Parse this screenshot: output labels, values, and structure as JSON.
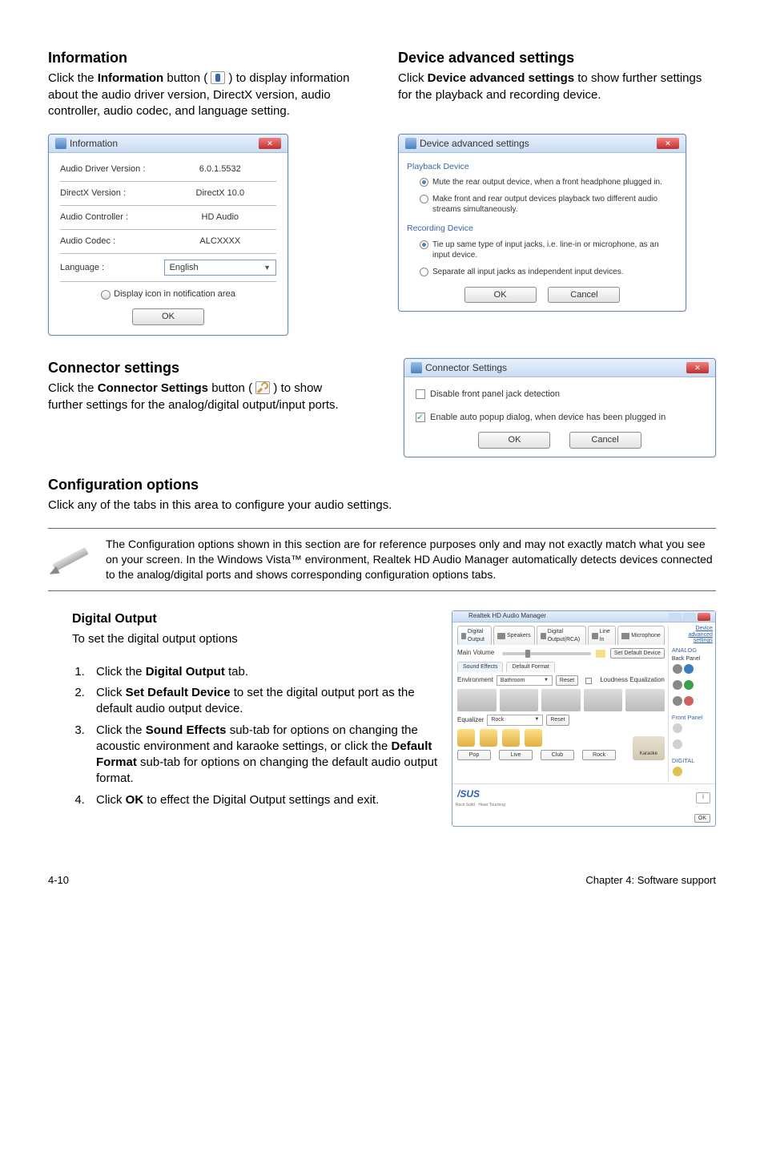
{
  "section1": {
    "left": {
      "heading": "Information",
      "para_a": "Click the ",
      "para_b": "Information",
      "para_c": " button ( ",
      "para_d": " ) to display information about the audio driver version, DirectX version, audio controller, audio codec, and language setting."
    },
    "right": {
      "heading": "Device advanced settings",
      "para_a": "Click ",
      "para_b": "Device advanced settings",
      "para_c": " to show further settings for the playback and recording device."
    }
  },
  "info_dlg": {
    "title": "Information",
    "rows": {
      "driver_label": "Audio Driver Version :",
      "driver_val": "6.0.1.5532",
      "directx_label": "DirectX Version :",
      "directx_val": "DirectX 10.0",
      "controller_label": "Audio Controller :",
      "controller_val": "HD Audio",
      "codec_label": "Audio Codec :",
      "codec_val": "ALCXXXX",
      "lang_label": "Language :",
      "lang_val": "English"
    },
    "notif": "Display icon in notification area",
    "ok": "OK"
  },
  "dev_dlg": {
    "title": "Device advanced settings",
    "playback_grp": "Playback Device",
    "opt1": "Mute the rear output device, when a front headphone plugged in.",
    "opt2": "Make front and rear output devices playback two different audio streams simultaneously.",
    "record_grp": "Recording Device",
    "opt3": "Tie up same type of input jacks, i.e. line-in or microphone, as an input device.",
    "opt4": "Separate all input jacks as independent input devices.",
    "ok": "OK",
    "cancel": "Cancel"
  },
  "conn": {
    "heading": "Connector settings",
    "para_a": "Click the ",
    "para_b": "Connector Settings",
    "para_c": " button ( ",
    "para_d": " ) to show further settings for the analog/digital output/input ports.",
    "dlg_title": "Connector Settings",
    "opt1": "Disable front panel jack detection",
    "opt2": "Enable auto popup dialog, when device has been plugged in",
    "ok": "OK",
    "cancel": "Cancel"
  },
  "cfg": {
    "heading": "Configuration options",
    "intro": "Click any of the tabs in this area to configure your audio settings.",
    "note": "The Configuration options shown in this section are for reference purposes only and may not exactly match what you see on your screen. In the Windows Vista™ environment, Realtek HD Audio Manager automatically detects devices connected to the analog/digital ports and shows corresponding configuration options tabs."
  },
  "digital": {
    "heading": "Digital Output",
    "intro": "To set the digital output options",
    "s1a": "Click the ",
    "s1b": "Digital Output",
    "s1c": " tab.",
    "s2a": "Click ",
    "s2b": "Set Default Device",
    "s2c": " to set the digital output port as the default audio output device.",
    "s3a": "Click the ",
    "s3b": "Sound Effects",
    "s3c": " sub-tab for options on changing the acoustic environment and karaoke settings, or click the ",
    "s3d": "Default Format",
    "s3e": " sub-tab for options on changing the default audio output format.",
    "s4a": "Click ",
    "s4b": "OK",
    "s4c": " to effect the Digital Output settings and exit."
  },
  "hdmgr": {
    "wintitle": "Realtek HD Audio Manager",
    "tab1": "Digital Output",
    "tab2": "Speakers",
    "tab3": "Digital Output(RCA)",
    "tab4": "Line In",
    "tab5": "Microphone",
    "adv_link": "Device advanced settings",
    "vol_label": "Main Volume",
    "set_default": "Set Default Device",
    "sub1": "Sound Effects",
    "sub2": "Default Format",
    "env_label": "Environment",
    "env_val": "Bathroom",
    "reset": "Reset",
    "loudness": "Loudness Equalization",
    "eq_label": "Equalizer",
    "eq_val": "Rock",
    "karaoke": "Karaoke",
    "btn_pop": "Pop",
    "btn_live": "Live",
    "btn_club": "Club",
    "btn_rock": "Rock",
    "right_analog": "ANALOG",
    "right_back": "Back Panel",
    "right_front": "Front Panel",
    "right_digital": "DIGITAL",
    "ok": "OK"
  },
  "footer": {
    "page": "4-10",
    "chapter": "Chapter 4: Software support"
  }
}
